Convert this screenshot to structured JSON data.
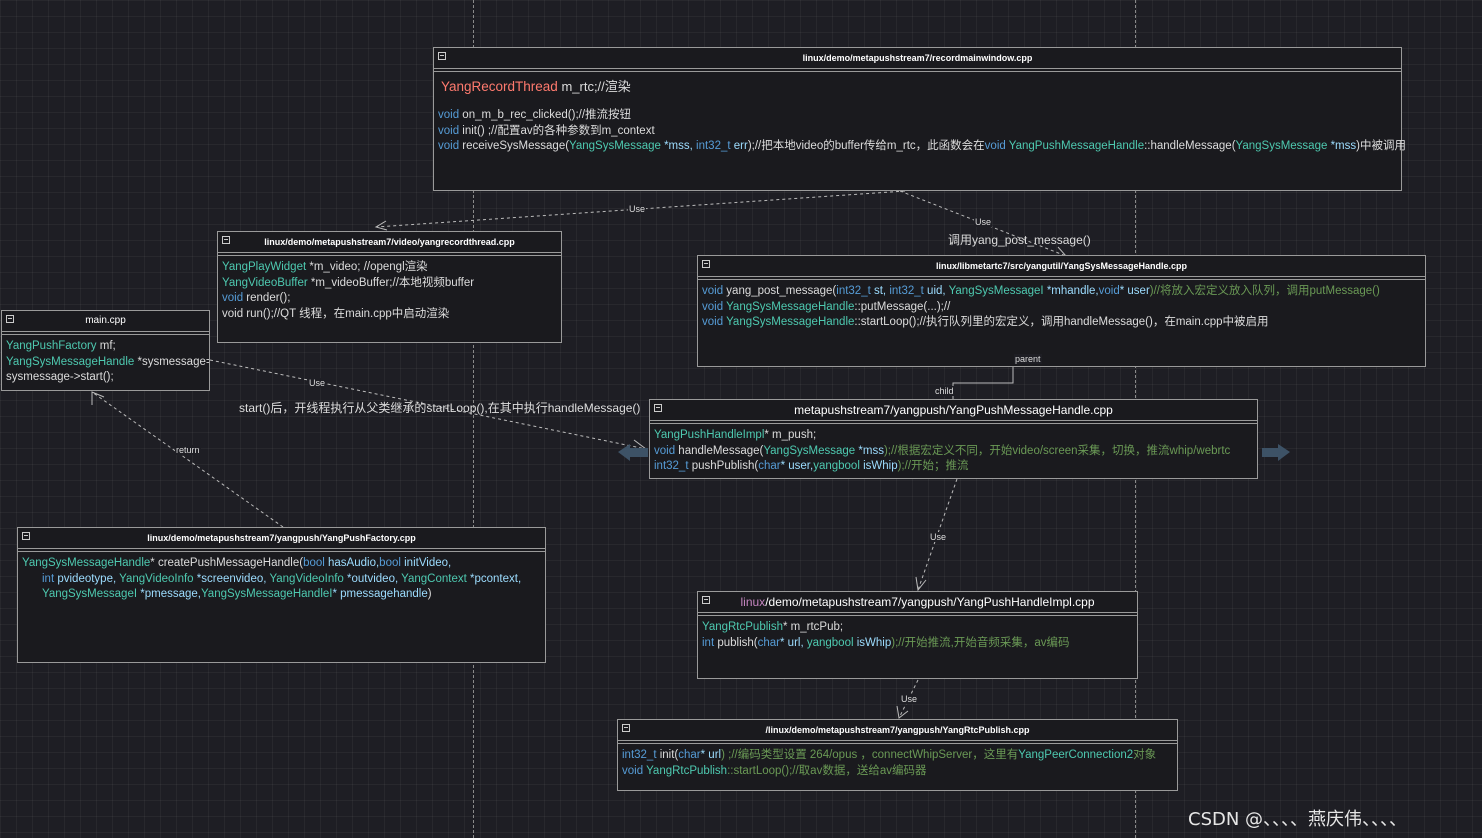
{
  "boxes": {
    "recordmainwindow": {
      "title": "linux/demo/metapushstream7/recordmainwindow.cpp",
      "l1_type": "YangRecordThread",
      "l1_rest": "  m_rtc;//渲染",
      "l2_k": "void",
      "l2_rest": " on_m_b_rec_clicked();//推流按钮",
      "l3_k": "void",
      "l3_rest": " init() ;//配置av的各种参数到m_context",
      "l4_k": "void",
      "l4_a": " receiveSysMessage(",
      "l4_t1": "YangSysMessage",
      "l4_p1": " *mss, ",
      "l4_k2": "int32_t",
      "l4_p2": " err",
      "l4_b": ");//把本地video的buffer传给m_rtc，此函数会在",
      "l4_k3": "void",
      "l4_c": " ",
      "l4_t2": "YangPushMessageHandle",
      "l4_d": "::handleMessage(",
      "l4_t3": "YangSysMessage",
      "l4_p3": " *mss",
      "l4_e": ")中被调用"
    },
    "yangrecordthread": {
      "title": "linux/demo/metapushstream7/video/yangrecordthread.cpp",
      "l1_t": "YangPlayWidget",
      "l1_r": " *m_video; //opengl渲染",
      "l2_t": "YangVideoBuffer",
      "l2_r": " *m_videoBuffer;//本地视频buffer",
      "l3_k": "void",
      "l3_r": " render();",
      "l4": "void run();//QT 线程，在main.cpp中启动渲染"
    },
    "maincpp": {
      "title": "main.cpp",
      "l1_t": "YangPushFactory",
      "l1_r": " mf;",
      "l2_t": "YangSysMessageHandle",
      "l2_r": " *sysmessage=",
      "l3": "sysmessage->start();"
    },
    "yangsysmessagehandle": {
      "title": "linux/libmetartc7/src/yangutil/YangSysMessageHandle.cpp",
      "l1_k": "void",
      "l1_a": " yang_post_message(",
      "l1_t1": "int32_t",
      "l1_p1": " st, ",
      "l1_t2": "int32_t",
      "l1_p2": " uid, ",
      "l1_t3": "YangSysMessageI",
      "l1_p3": " *mhandle,",
      "l1_k2": "void",
      "l1_p4": "* user",
      "l1_c": ")//将放入宏定义放入队列，调用putMessage()",
      "l2_k": "void",
      "l2_sp": " ",
      "l2_t": "YangSysMessageHandle",
      "l2_r": "::putMessage(...);//",
      "l3_k": "void",
      "l3_sp": " ",
      "l3_t": "YangSysMessageHandle",
      "l3_r": "::startLoop();//执行队列里的宏定义，调用handleMessage()，在main.cpp中被启用"
    },
    "yangpushmessagehandle": {
      "title": "metapushstream7/yangpush/YangPushMessageHandle.cpp",
      "l1_t": "YangPushHandleImpl",
      "l1_r": "* m_push;",
      "l2_k": "void",
      "l2_a": " handleMessage(",
      "l2_t": "YangSysMessage",
      "l2_p": " *mss",
      "l2_c": ");//根据宏定义不同，开始video/screen采集，切换，推流whip/webrtc",
      "l3_t": "int32_t",
      "l3_a": " pushPublish(",
      "l3_k": "char",
      "l3_p": "* user,",
      "l3_t2": "yangbool",
      "l3_p2": " isWhip",
      "l3_c": ");//开始；推流"
    },
    "yangpushfactory": {
      "title": "linux/demo/metapushstream7/yangpush/YangPushFactory.cpp",
      "l1_t": "YangSysMessageHandle",
      "l1_a": "* createPushMessageHandle(",
      "l1_k1": "bool",
      "l1_p1": " hasAudio,",
      "l1_k2": "bool",
      "l1_p2": " initVideo,",
      "l2_k": "int",
      "l2_p1": " pvideotype, ",
      "l2_t1": "YangVideoInfo",
      "l2_p2": " *screenvideo, ",
      "l2_t2": "YangVideoInfo",
      "l2_p3": " *outvideo, ",
      "l2_t3": "YangContext",
      "l2_p4": " *pcontext,",
      "l3_t1": "YangSysMessageI",
      "l3_p1": " *pmessage,",
      "l3_t2": "YangSysMessageHandleI",
      "l3_p2": "* pmessagehandle",
      "l3_e": ")"
    },
    "yangpushhandleimpl": {
      "title_m": "linux",
      "title_r": "/demo/metapushstream7/yangpush/YangPushHandleImpl.cpp",
      "l1_t": "YangRtcPublish",
      "l1_r": "* m_rtcPub;",
      "l2_k": "int",
      "l2_a": " publish(",
      "l2_k2": "char",
      "l2_p": "* url, ",
      "l2_t": "yangbool",
      "l2_p2": " isWhip",
      "l2_c": ");//开始推流,开始音频采集，av编码"
    },
    "yangrtcpublish": {
      "title": "/linux/demo/metapushstream7/yangpush/YangRtcPublish.cpp",
      "l1_t": "int32_t",
      "l1_a": " init(",
      "l1_k": "char",
      "l1_p": "* url",
      "l1_c": ") ;//编码类型设置 264/opus ，connectWhipServer，这里有",
      "l1_t2": "YangPeerConnection2",
      "l1_c2": "对象",
      "l2_k": "void",
      "l2_sp": " ",
      "l2_t": "YangRtcPublish",
      "l2_r": "::startLoop();//取av数据，送给av编码器"
    }
  },
  "edges": {
    "use1": "Use",
    "use2": "Use",
    "use2_note": "调用yang_post_message()",
    "parent": "parent",
    "child": "child",
    "use3": "Use",
    "use3_note": "start()后，开线程执行从父类继承的startLoop(),在其中执行handleMessage()",
    "return": "return",
    "use4": "Use",
    "use5": "Use"
  },
  "watermark": "CSDN @、、、、燕庆伟、、、、",
  "colors": {
    "type": "#4ec9b0",
    "keyword": "#569cd6",
    "param": "#9cdcfe",
    "comment": "#6a9955",
    "highlight": "#ff7a6e",
    "background": "#1e1e24"
  }
}
